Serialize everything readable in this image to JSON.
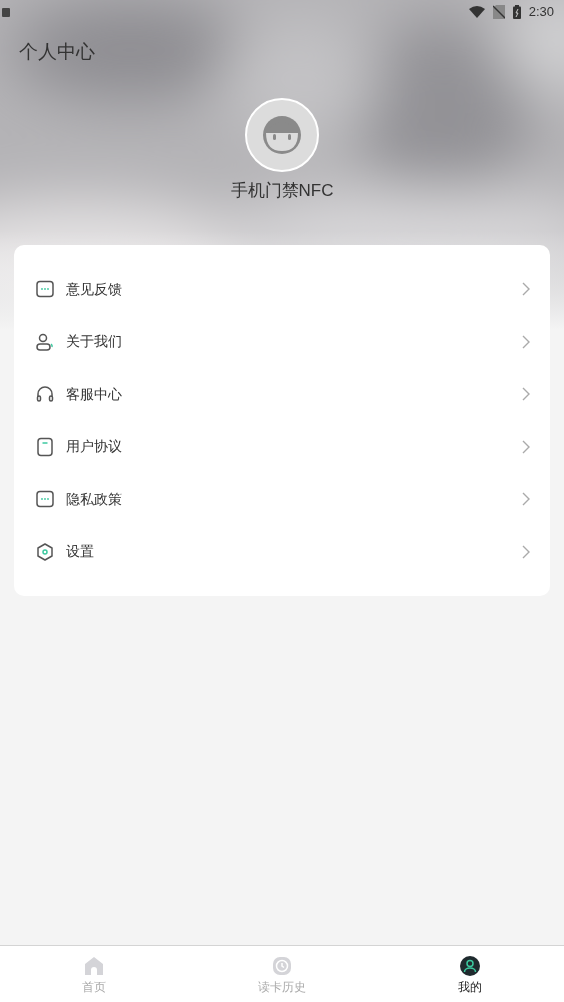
{
  "status_bar": {
    "time": "2:30"
  },
  "header": {
    "title": "个人中心",
    "name": "手机门禁NFC"
  },
  "menu": [
    {
      "label": "意见反馈",
      "kind": "chat"
    },
    {
      "label": "关于我们",
      "kind": "person"
    },
    {
      "label": "客服中心",
      "kind": "headset"
    },
    {
      "label": "用户协议",
      "kind": "doc"
    },
    {
      "label": "隐私政策",
      "kind": "chat"
    },
    {
      "label": "设置",
      "kind": "hex"
    }
  ],
  "tabs": [
    {
      "label": "首页",
      "kind": "home",
      "selected": false
    },
    {
      "label": "读卡历史",
      "kind": "clock",
      "selected": false
    },
    {
      "label": "我的",
      "kind": "me",
      "selected": true
    }
  ]
}
